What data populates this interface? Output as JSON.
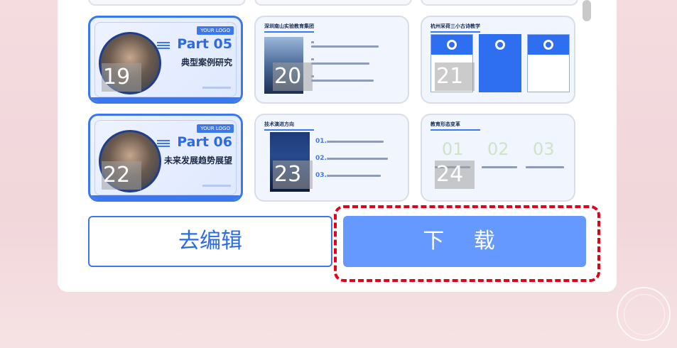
{
  "slides": [
    {
      "num": "19",
      "kind": "cover",
      "logo": "YOUR LOGO",
      "part": "Part 05",
      "subtitle": "典型案例研究",
      "selected": true
    },
    {
      "num": "20",
      "kind": "content",
      "title": "深圳南山实验教育集团"
    },
    {
      "num": "21",
      "kind": "content",
      "title": "杭州采荷三小古诗教学"
    },
    {
      "num": "22",
      "kind": "cover",
      "logo": "YOUR LOGO",
      "part": "Part 06",
      "subtitle": "未来发展趋势展望",
      "selected": true
    },
    {
      "num": "23",
      "kind": "content",
      "title": "技术演进方向",
      "list_numbers": [
        "01.",
        "02.",
        "03."
      ]
    },
    {
      "num": "24",
      "kind": "content",
      "title": "教育形态变革",
      "big_numbers": [
        "01",
        "02",
        "03"
      ]
    }
  ],
  "actions": {
    "edit_label": "去编辑",
    "download_label": "下 载"
  },
  "colors": {
    "accent": "#3b78f0",
    "download_bg": "#6699ff",
    "highlight": "#e3001b"
  }
}
